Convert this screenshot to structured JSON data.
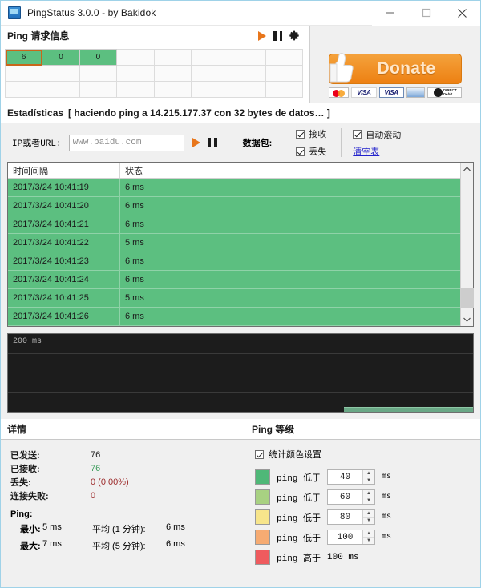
{
  "window": {
    "title": "PingStatus 3.0.0 - by Bakidok",
    "app_icon": "monitor-icon",
    "minimize": "—",
    "maximize": "□",
    "close": "✕"
  },
  "ping_request": {
    "header": "Ping 请求信息",
    "play": "play-icon",
    "pause": "pause-icon",
    "settings": "gear-icon",
    "cells": [
      "6",
      "0",
      "0"
    ],
    "columns": 8,
    "rows": 3,
    "selected_index": 0,
    "filled_color": "#5cbf80",
    "selection_color": "#c8661a"
  },
  "donate": {
    "label": "Donate",
    "cards": [
      "MasterCard",
      "VISA",
      "VISA",
      "AMEX",
      "DIRECT Debit"
    ]
  },
  "stats": {
    "header": "Estadísticas",
    "subheader": "[ haciendo ping a 14.215.177.37 con 32 bytes de datos… ]",
    "url_label": "IP或者URL:",
    "url_value": "www.baidu.com",
    "url_placeholder": "www.baidu.com",
    "packets_label": "数据包:",
    "check_received": "接收",
    "check_lost": "丢失",
    "check_autoscroll": "自动滚动",
    "clear_link": "清空表",
    "received_checked": true,
    "lost_checked": true,
    "autoscroll_checked": true
  },
  "log_table": {
    "columns": [
      "时间间隔",
      "状态"
    ],
    "rows": [
      {
        "time": "2017/3/24  10:41:19",
        "status": "6 ms"
      },
      {
        "time": "2017/3/24  10:41:20",
        "status": "6 ms"
      },
      {
        "time": "2017/3/24  10:41:21",
        "status": "6 ms"
      },
      {
        "time": "2017/3/24  10:41:22",
        "status": "5 ms"
      },
      {
        "time": "2017/3/24  10:41:23",
        "status": "6 ms"
      },
      {
        "time": "2017/3/24  10:41:24",
        "status": "6 ms"
      },
      {
        "time": "2017/3/24  10:41:25",
        "status": "5 ms"
      },
      {
        "time": "2017/3/24  10:41:26",
        "status": "6 ms"
      }
    ]
  },
  "graph": {
    "axis_label": "200 ms",
    "gridlines": 4,
    "background": "#1c1c1c",
    "series_color": "#6aa886"
  },
  "details": {
    "header": "详情",
    "rows": [
      {
        "key": "已发送:",
        "value": "76",
        "tone": "plain"
      },
      {
        "key": "已接收:",
        "value": "76",
        "tone": "green"
      },
      {
        "key": "丢失:",
        "value": "0  (0.00%)",
        "tone": "red"
      },
      {
        "key": "连接失败:",
        "value": "0",
        "tone": "red"
      }
    ],
    "ping_title": "Ping:",
    "min_label": "最小:",
    "min_value": "5 ms",
    "max_label": "最大:",
    "max_value": "7 ms",
    "avg1_label": "平均 (1 分钟):",
    "avg1_value": "6 ms",
    "avg5_label": "平均 (5 分钟):",
    "avg5_value": "6 ms"
  },
  "ping_level": {
    "header": "Ping 等级",
    "color_settings_label": "统计颜色设置",
    "color_settings_checked": true,
    "unit": "ms",
    "levels": [
      {
        "color": "#4fb878",
        "text": "ping 低于",
        "value": "40",
        "unit": "ms",
        "has_input": true
      },
      {
        "color": "#a8d182",
        "text": "ping 低于",
        "value": "60",
        "unit": "ms",
        "has_input": true
      },
      {
        "color": "#f7e58b",
        "text": "ping 低于",
        "value": "80",
        "unit": "ms",
        "has_input": true
      },
      {
        "color": "#f6ab72",
        "text": "ping 低于",
        "value": "100",
        "unit": "ms",
        "has_input": true
      },
      {
        "color": "#ef5b5e",
        "text": "ping 高于",
        "value": "100 ms",
        "unit": "",
        "has_input": false
      }
    ]
  }
}
